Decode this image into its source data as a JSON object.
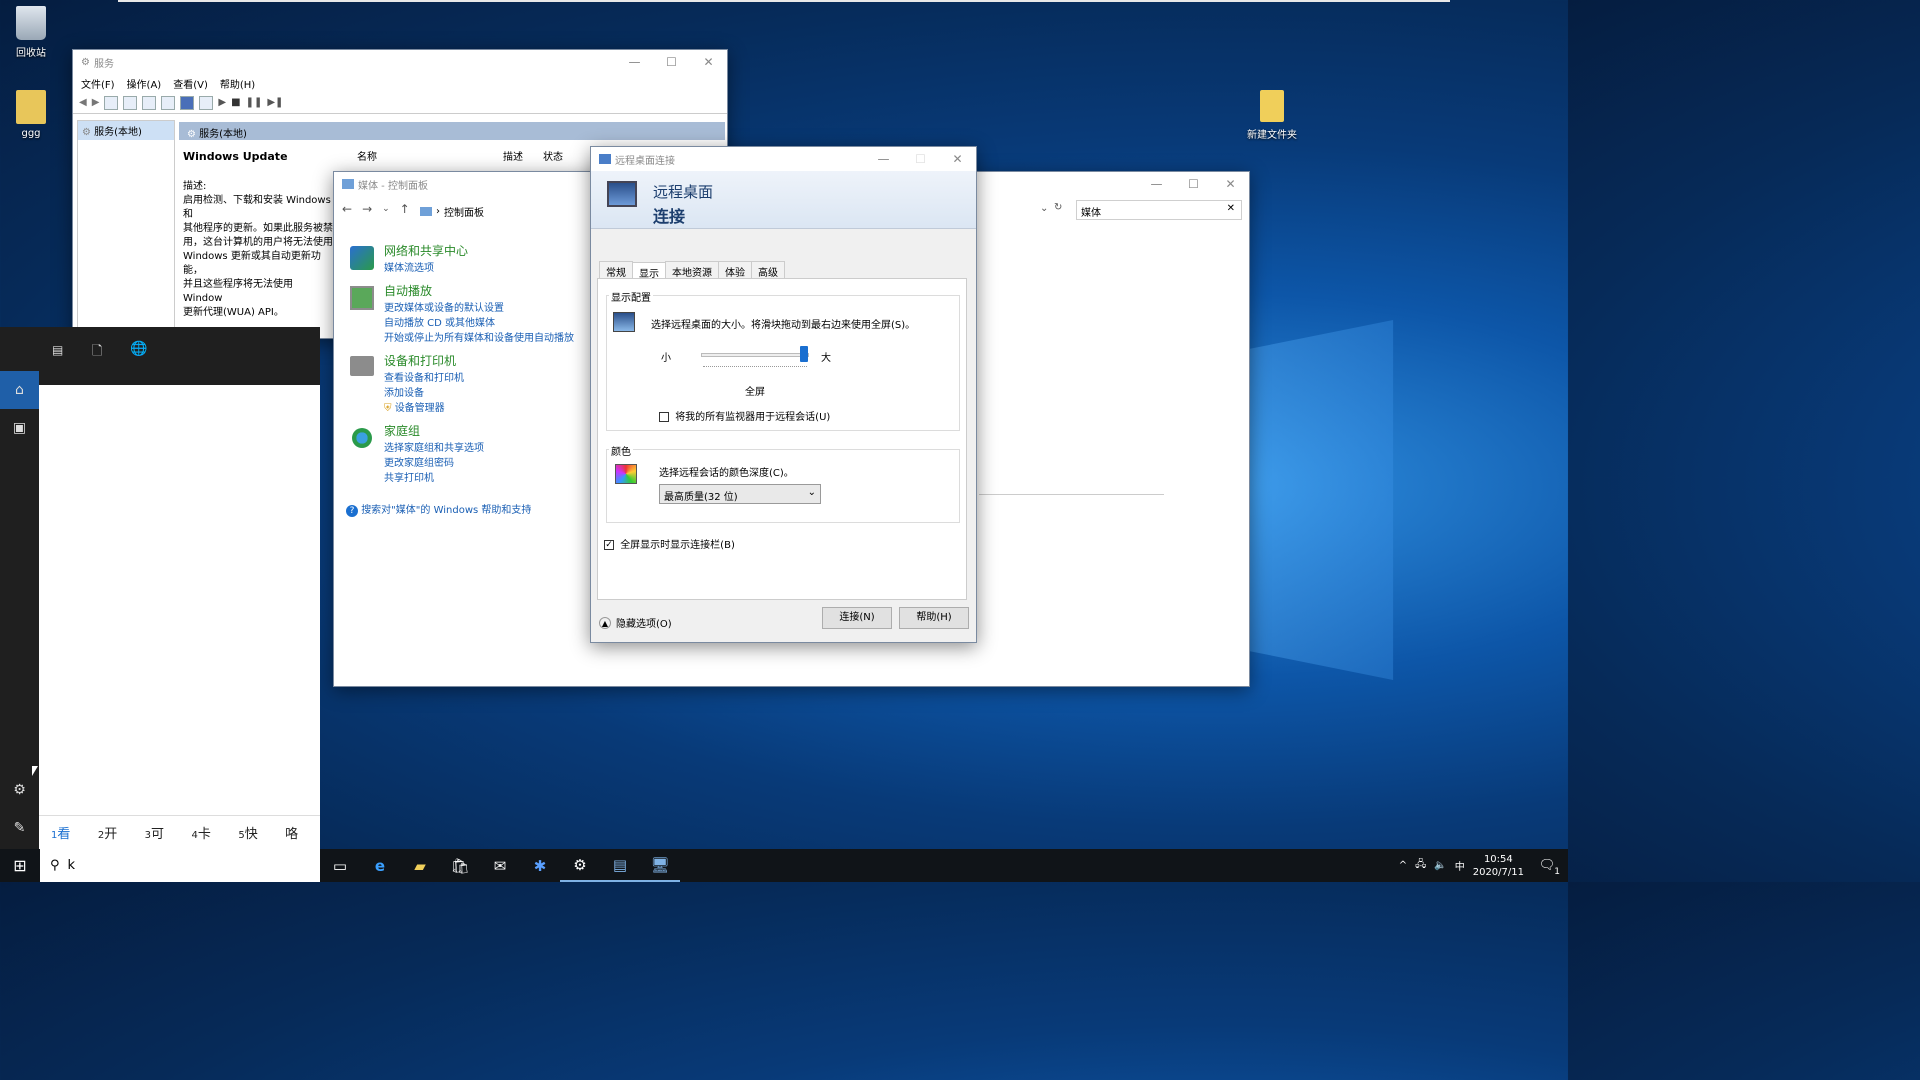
{
  "desktop": {
    "icons": [
      {
        "label": "回收站",
        "icon": "recycle-bin-icon"
      },
      {
        "label": "ggg",
        "icon": "user-folder-icon"
      },
      {
        "label": "新建文件夹",
        "icon": "folder-icon"
      }
    ]
  },
  "services_window": {
    "title": "服务",
    "menus": [
      "文件(F)",
      "操作(A)",
      "查看(V)",
      "帮助(H)"
    ],
    "tree_item": "服务(本地)",
    "header": "服务(本地)",
    "selected_service": "Windows Update",
    "desc_label": "描述:",
    "desc_lines": [
      "启用检测、下载和安装 Windows 和",
      "其他程序的更新。如果此服务被禁",
      "用，这台计算机的用户将无法使用",
      "Windows 更新或其自动更新功能，",
      "并且这些程序将无法使用 Window",
      "更新代理(WUA) API。"
    ],
    "columns": [
      "名称",
      "描述",
      "状态"
    ]
  },
  "control_panel": {
    "title": "媒体 - 控制面板",
    "breadcrumb": "控制面板",
    "search_value": "媒体",
    "results": [
      {
        "heading": "网络和共享中心",
        "links": [
          "媒体流选项"
        ],
        "icon": "network-icon"
      },
      {
        "heading": "自动播放",
        "links": [
          "更改媒体或设备的默认设置",
          "自动播放 CD 或其他媒体",
          "开始或停止为所有媒体和设备使用自动播放"
        ],
        "icon": "autoplay-icon"
      },
      {
        "heading": "设备和打印机",
        "links": [
          "查看设备和打印机",
          "添加设备",
          "设备管理器"
        ],
        "icon": "printer-icon"
      },
      {
        "heading": "家庭组",
        "links": [
          "选择家庭组和共享选项",
          "更改家庭组密码",
          "共享打印机"
        ],
        "icon": "homegroup-icon"
      }
    ],
    "help_link": "搜索对\"媒体\"的 Windows 帮助和支持"
  },
  "rdp_dialog": {
    "title": "远程桌面连接",
    "banner_line1": "远程桌面",
    "banner_line2": "连接",
    "tabs": [
      "常规",
      "显示",
      "本地资源",
      "体验",
      "高级"
    ],
    "active_tab": "显示",
    "display_group": "显示配置",
    "display_desc": "选择远程桌面的大小。将滑块拖动到最右边来使用全屏(S)。",
    "slider_small": "小",
    "slider_large": "大",
    "slider_value_label": "全屏",
    "slider_position": 1.0,
    "monitors_checkbox": "将我的所有监视器用于远程会话(U)",
    "monitors_checked": false,
    "color_group": "颜色",
    "color_desc": "选择远程会话的颜色深度(C)。",
    "color_value": "最高质量(32 位)",
    "connbar_checkbox": "全屏显示时显示连接栏(B)",
    "connbar_checked": true,
    "hide_options": "隐藏选项(O)",
    "connect_btn": "连接(N)",
    "help_btn": "帮助(H)"
  },
  "ime": {
    "candidates": [
      {
        "num": "1",
        "text": "看"
      },
      {
        "num": "2",
        "text": "开"
      },
      {
        "num": "3",
        "text": "可"
      },
      {
        "num": "4",
        "text": "卡"
      },
      {
        "num": "5",
        "text": "快"
      },
      {
        "num": "",
        "text": "咯"
      }
    ]
  },
  "search_box": {
    "value": "k"
  },
  "taskbar": {
    "clock_time": "10:54",
    "clock_date": "2020/7/11",
    "ime_indicator": "中",
    "notification_count": "1"
  },
  "colors": {
    "accent": "#1f5fa8",
    "link": "#1a5fb4",
    "heading_green": "#2a8a2a"
  }
}
